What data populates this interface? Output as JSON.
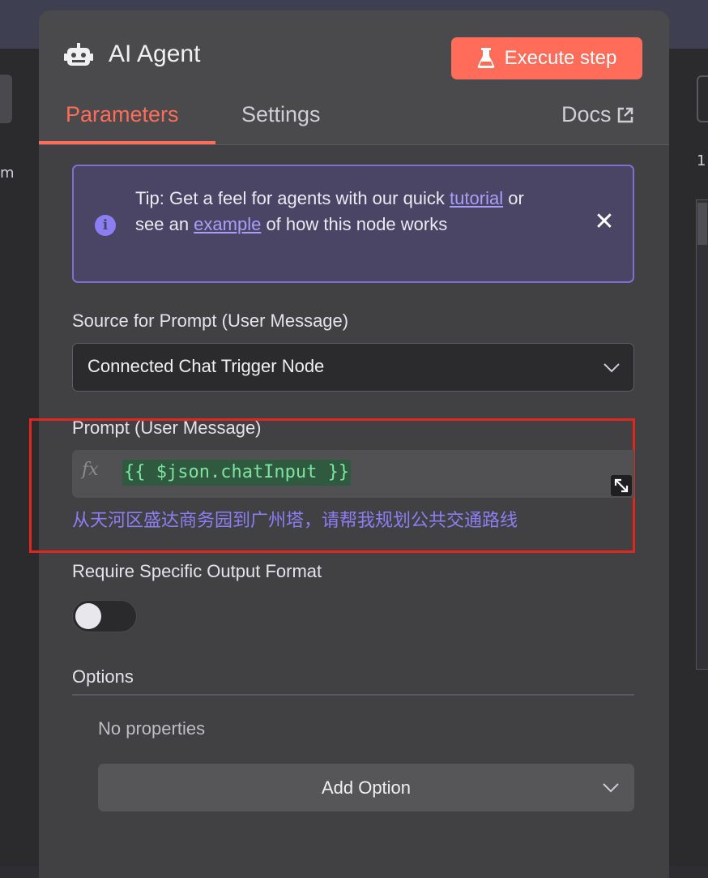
{
  "node": {
    "title": "AI Agent",
    "icon": "robot-icon"
  },
  "toolbar": {
    "execute_label": "Execute step",
    "execute_icon": "flask-icon",
    "accent_color": "#ff6d5a"
  },
  "tabs": [
    {
      "label": "Parameters",
      "active": true
    },
    {
      "label": "Settings",
      "active": false
    }
  ],
  "docs": {
    "label": "Docs",
    "icon": "external-link-icon"
  },
  "tip": {
    "text_before": "Tip: Get a feel for agents with our quick ",
    "link1": "tutorial",
    "text_middle": " or see an ",
    "link2": "example",
    "text_after": " of how this node works"
  },
  "source_prompt": {
    "label": "Source for Prompt (User Message)",
    "value": "Connected Chat Trigger Node"
  },
  "prompt": {
    "label": "Prompt (User Message)",
    "fx": "fx",
    "expression": "{{ $json.chatInput }}",
    "resolved": "从天河区盛达商务园到广州塔，请帮我规划公共交通路线"
  },
  "output_format": {
    "label": "Require Specific Output Format",
    "enabled": false
  },
  "options": {
    "label": "Options",
    "empty_text": "No properties",
    "add_label": "Add Option"
  },
  "background": {
    "left_fragment": "m",
    "right_fragment": "1"
  }
}
